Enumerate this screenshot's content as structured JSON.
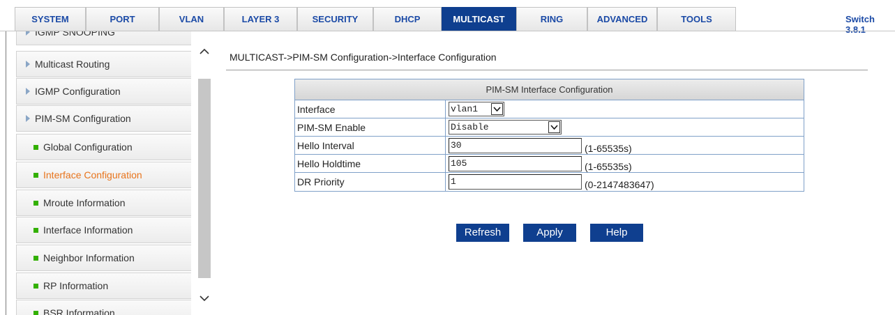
{
  "nav": {
    "tabs": [
      {
        "label": "SYSTEM",
        "active": false
      },
      {
        "label": "PORT",
        "active": false
      },
      {
        "label": "VLAN",
        "active": false
      },
      {
        "label": "LAYER 3",
        "active": false
      },
      {
        "label": "SECURITY",
        "active": false
      },
      {
        "label": "DHCP",
        "active": false
      },
      {
        "label": "MULTICAST",
        "active": true
      },
      {
        "label": "RING",
        "active": false
      },
      {
        "label": "ADVANCED",
        "active": false
      },
      {
        "label": "TOOLS",
        "active": false
      }
    ],
    "version": "Switch 3.8.1"
  },
  "sidebar": {
    "items": [
      {
        "label": "IGMP SNOOPING",
        "type": "parent"
      },
      {
        "label": "Multicast Routing",
        "type": "parent"
      },
      {
        "label": "IGMP Configuration",
        "type": "parent"
      },
      {
        "label": "PIM-SM Configuration",
        "type": "parent"
      },
      {
        "label": "Global Configuration",
        "type": "child"
      },
      {
        "label": "Interface Configuration",
        "type": "child",
        "selected": true
      },
      {
        "label": "Mroute Information",
        "type": "child"
      },
      {
        "label": "Interface Information",
        "type": "child"
      },
      {
        "label": "Neighbor Information",
        "type": "child"
      },
      {
        "label": "RP Information",
        "type": "child"
      },
      {
        "label": "BSR Information",
        "type": "child"
      }
    ]
  },
  "main": {
    "breadcrumb": "MULTICAST->PIM-SM Configuration->Interface Configuration",
    "table_title": "PIM-SM Interface Configuration",
    "fields": {
      "interface": {
        "label": "Interface",
        "value": "vlan1"
      },
      "enable": {
        "label": "PIM-SM Enable",
        "value": "Disable"
      },
      "hello_interval": {
        "label": "Hello Interval",
        "value": "30",
        "range": "(1-65535s)"
      },
      "hello_holdtime": {
        "label": "Hello Holdtime",
        "value": "105",
        "range": "(1-65535s)"
      },
      "dr_priority": {
        "label": "DR Priority",
        "value": "1",
        "range": "(0-2147483647)"
      }
    },
    "buttons": {
      "refresh": "Refresh",
      "apply": "Apply",
      "help": "Help"
    }
  },
  "colors": {
    "nav_active": "#0f3f8f",
    "nav_text": "#1b4aa6",
    "selected_item": "#e8741c",
    "bullet": "#33b000",
    "button": "#0f3f8f"
  },
  "icons": {
    "scroll_up": "chevron-up-icon",
    "scroll_down": "chevron-down-icon",
    "parent_bullet": "triangle-right-icon",
    "child_bullet": "square-bullet-icon"
  }
}
